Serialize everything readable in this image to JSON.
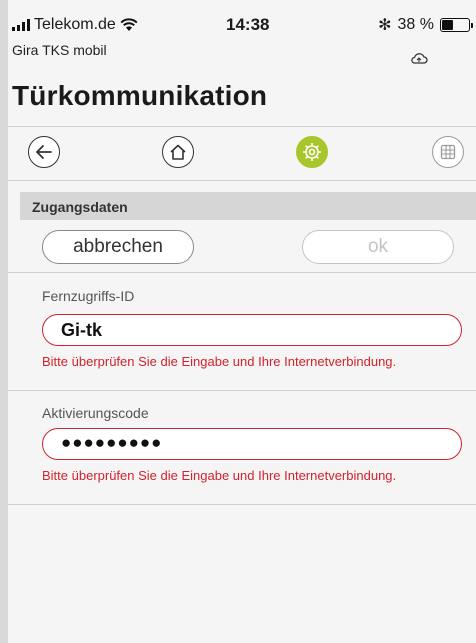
{
  "status_bar": {
    "carrier": "Telekom.de",
    "time": "14:38",
    "bluetooth": "✻",
    "battery_percent": "38 %",
    "battery_level": 0.38
  },
  "app": {
    "name": "Gira TKS mobil",
    "title": "Türkommunikation"
  },
  "nav": {
    "items": [
      {
        "icon": "back-arrow-icon",
        "active": false
      },
      {
        "icon": "home-icon",
        "active": false
      },
      {
        "icon": "settings-gear-icon",
        "active": true
      },
      {
        "icon": "grid-icon",
        "active": false
      }
    ],
    "accent_color": "#a8c62a"
  },
  "section": {
    "title": "Zugangsdaten"
  },
  "actions": {
    "cancel_label": "abbrechen",
    "ok_label": "ok"
  },
  "form": {
    "remote_id": {
      "label": "Fernzugriffs-ID",
      "value": "Gi-tk",
      "error": "Bitte überprüfen Sie die Eingabe und Ihre Internetverbindung."
    },
    "activation_code": {
      "label": "Aktivierungscode",
      "value": "●●●●●●●●●",
      "error": "Bitte überprüfen Sie die Eingabe und Ihre Internetverbindung."
    },
    "error_color": "#d2222d"
  }
}
